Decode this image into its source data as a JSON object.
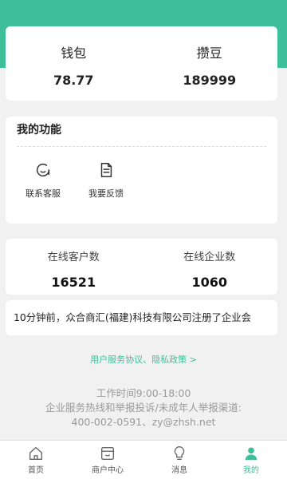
{
  "colors": {
    "accent": "#3dbf9a",
    "background": "#f1f1f1",
    "card": "#ffffff"
  },
  "wallet": {
    "wallet_label": "钱包",
    "wallet_value": "78.77",
    "beans_label": "攒豆",
    "beans_value": "189999"
  },
  "functions": {
    "title": "我的功能",
    "items": [
      {
        "label": "联系客服",
        "icon": "customer-service-icon"
      },
      {
        "label": "我要反馈",
        "icon": "feedback-document-icon"
      }
    ]
  },
  "counts": {
    "customers_label": "在线客户数",
    "customers_value": "16521",
    "companies_label": "在线企业数",
    "companies_value": "1060"
  },
  "news": {
    "text": "10分钟前，众合商汇(福建)科技有限公司注册了企业会"
  },
  "policy": {
    "link": "用户服务协议、隐私政策 >"
  },
  "footer": {
    "hours": "工作时间9:00-18:00",
    "hotline_label": "企业服务热线和举报投诉/未成年人举报渠道:",
    "contact": "400-002-0591、zy@zhsh.net"
  },
  "tabbar": {
    "items": [
      {
        "label": "首页",
        "icon": "home-icon"
      },
      {
        "label": "商户中心",
        "icon": "merchant-store-icon"
      },
      {
        "label": "消息",
        "icon": "lightbulb-message-icon"
      },
      {
        "label": "我的",
        "icon": "user-profile-icon"
      }
    ],
    "active": "我的"
  }
}
